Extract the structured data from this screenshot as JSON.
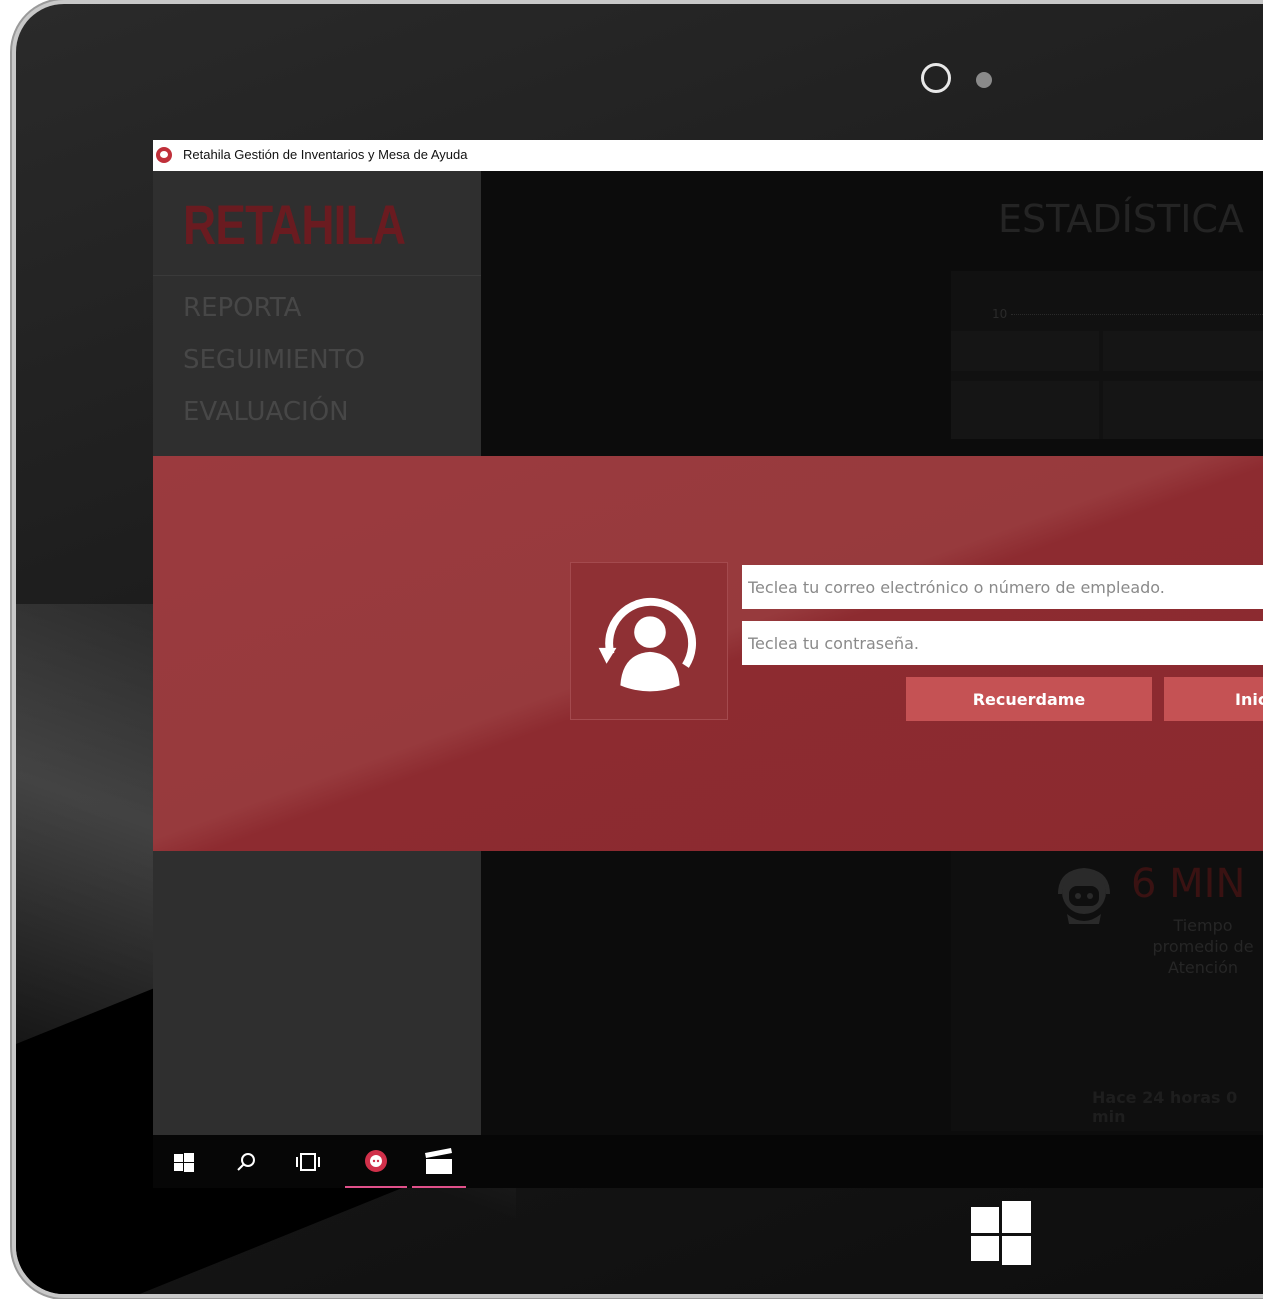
{
  "window": {
    "title": "Retahila Gestión de Inventarios y Mesa de Ayuda"
  },
  "sidebar": {
    "logo": "RETAHILA",
    "items": [
      {
        "label": "REPORTA"
      },
      {
        "label": "SEGUIMIENTO"
      },
      {
        "label": "EVALUACIÓN"
      }
    ]
  },
  "main": {
    "title": "ESTADÍSTICA",
    "chart_tick": "10",
    "stat_value": "6 MIN",
    "stat_label": "Tiempo promedio de Atención",
    "stat_time": "Hace 24 horas 0 min"
  },
  "login": {
    "email_placeholder": "Teclea tu correo electrónico o número de empleado.",
    "password_placeholder": "Teclea tu contraseña.",
    "remember_label": "Recuerdame",
    "login_label": "Inic"
  },
  "taskbar": {
    "items": [
      "start-icon",
      "search-icon",
      "task-view-icon",
      "retahila-app-icon",
      "clapperboard-icon"
    ]
  },
  "colors": {
    "accent": "#c55254",
    "banner": "#973a3d",
    "logo": "#6a1b20",
    "taskbar_active": "#e0508a"
  }
}
